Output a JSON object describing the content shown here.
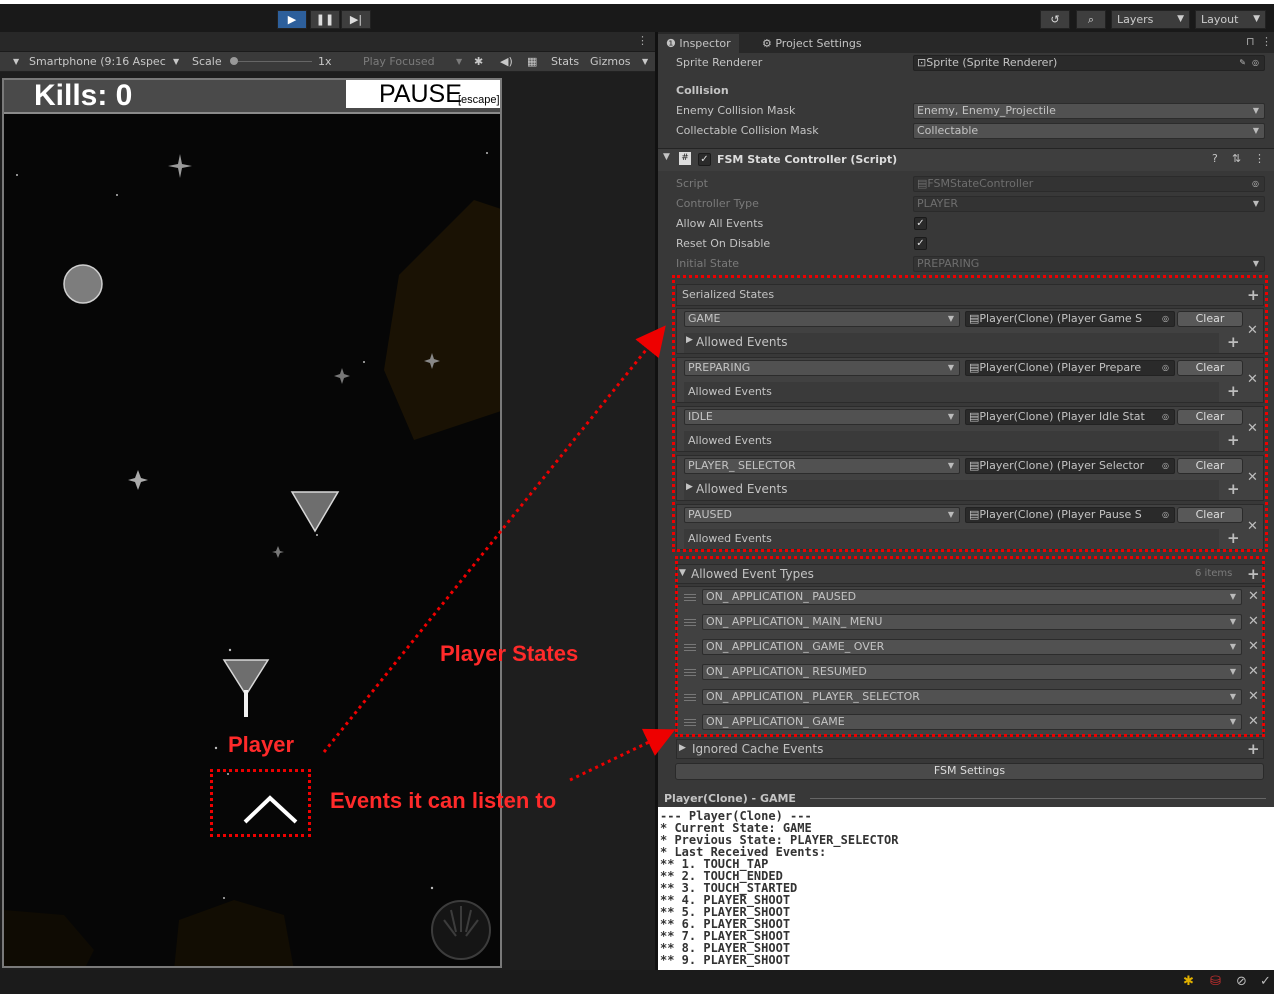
{
  "toolbar": {
    "layers_label": "Layers",
    "layout_label": "Layout",
    "play_icon": "play-icon",
    "pause_icon": "pause-icon",
    "step_icon": "step-icon"
  },
  "game_bar": {
    "aspect": "Smartphone (9:16 Aspec",
    "scale_label": "Scale",
    "scale_value": "1x",
    "play_mode": "Play Focused",
    "stats_label": "Stats",
    "gizmos_label": "Gizmos"
  },
  "game": {
    "kills": "Kills: 0",
    "pause_label": "PAUSE",
    "pause_hint": "[escape]"
  },
  "annotations": {
    "player": "Player",
    "player_states": "Player States",
    "events": "Events it can listen to",
    "color": "#ff2a2a"
  },
  "inspector": {
    "tabs": [
      "Inspector",
      "Project Settings"
    ],
    "sprite_renderer_label": "Sprite Renderer",
    "sprite_renderer_value": "Sprite (Sprite Renderer)",
    "collision_heading": "Collision",
    "enemy_mask_label": "Enemy Collision Mask",
    "enemy_mask_value": "Enemy, Enemy_Projectile",
    "collect_mask_label": "Collectable Collision Mask",
    "collect_mask_value": "Collectable",
    "component_title": "FSM State Controller (Script)",
    "script_label": "Script",
    "script_value": "FSMStateController",
    "controller_type_label": "Controller Type",
    "controller_type_value": "PLAYER",
    "allow_all_label": "Allow All Events",
    "reset_label": "Reset On Disable",
    "initial_state_label": "Initial State",
    "initial_state_value": "PREPARING",
    "serialized_states_label": "Serialized States",
    "clear_label": "Clear",
    "allowed_events_label": "Allowed Events",
    "states": [
      {
        "name": "GAME",
        "object": "Player(Clone) (Player Game S"
      },
      {
        "name": "PREPARING",
        "object": "Player(Clone) (Player Prepare"
      },
      {
        "name": "IDLE",
        "object": "Player(Clone) (Player Idle Stat"
      },
      {
        "name": "PLAYER_ SELECTOR",
        "object": "Player(Clone) (Player Selector"
      },
      {
        "name": "PAUSED",
        "object": "Player(Clone) (Player Pause S"
      }
    ],
    "allowed_event_types_label": "Allowed Event Types",
    "items_count": "6 items",
    "event_types": [
      "ON_ APPLICATION_ PAUSED",
      "ON_ APPLICATION_ MAIN_ MENU",
      "ON_ APPLICATION_ GAME_ OVER",
      "ON_ APPLICATION_ RESUMED",
      "ON_ APPLICATION_ PLAYER_ SELECTOR",
      "ON_ APPLICATION_ GAME"
    ],
    "ignored_cache_label": "Ignored Cache Events",
    "fsm_settings_label": "FSM Settings"
  },
  "console": {
    "title": "Player(Clone) - GAME",
    "lines": [
      "--- Player(Clone) ---",
      "* Current State: GAME",
      "* Previous State: PLAYER_SELECTOR",
      "* Last Received Events:",
      "** 1. TOUCH_TAP",
      "** 2. TOUCH_ENDED",
      "** 3. TOUCH_STARTED",
      "** 4. PLAYER_SHOOT",
      "** 5. PLAYER_SHOOT",
      "** 6. PLAYER_SHOOT",
      "** 7. PLAYER_SHOOT",
      "** 8. PLAYER_SHOOT",
      "** 9. PLAYER_SHOOT"
    ]
  }
}
